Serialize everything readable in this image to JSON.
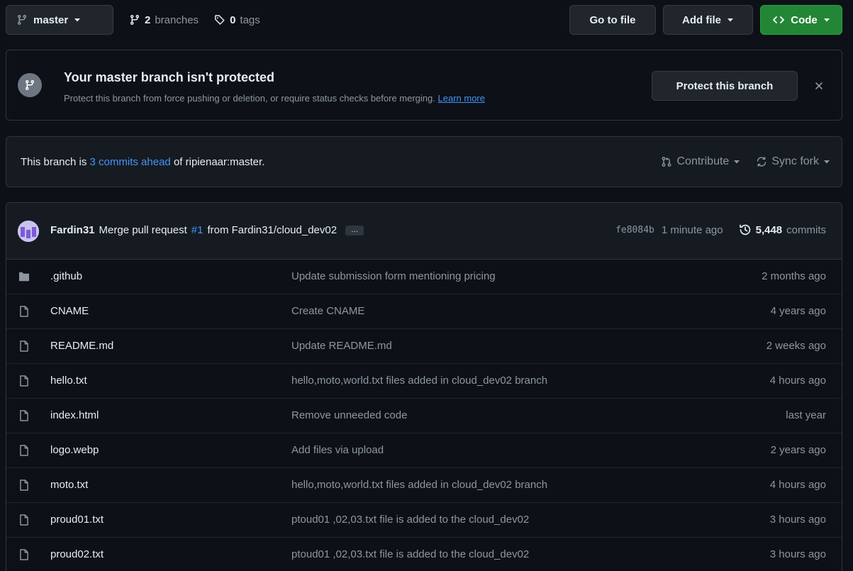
{
  "toolbar": {
    "branch": "master",
    "branches_count": "2",
    "branches_label": "branches",
    "tags_count": "0",
    "tags_label": "tags",
    "goto_label": "Go to file",
    "addfile_label": "Add file",
    "code_label": "Code"
  },
  "banner": {
    "title": "Your master branch isn't protected",
    "description": "Protect this branch from force pushing or deletion, or require status checks before merging.",
    "learn_more": "Learn more",
    "protect_label": "Protect this branch"
  },
  "ahead": {
    "prefix": "This branch is",
    "link": "3 commits ahead",
    "suffix": "of ripienaar:master.",
    "contribute_label": "Contribute",
    "sync_label": "Sync fork"
  },
  "latest_commit": {
    "author": "Fardin31",
    "message_prefix": "Merge pull request",
    "pr_link": "#1",
    "message_suffix": "from Fardin31/cloud_dev02",
    "ellipsis": "…",
    "sha": "fe8084b",
    "time": "1 minute ago",
    "commit_count": "5,448",
    "commit_label": "commits"
  },
  "files": [
    {
      "type": "folder",
      "name": ".github",
      "message": "Update submission form mentioning pricing",
      "time": "2 months ago"
    },
    {
      "type": "file",
      "name": "CNAME",
      "message": "Create CNAME",
      "time": "4 years ago"
    },
    {
      "type": "file",
      "name": "README.md",
      "message": "Update README.md",
      "time": "2 weeks ago"
    },
    {
      "type": "file",
      "name": "hello.txt",
      "message": "hello,moto,world.txt files added in cloud_dev02 branch",
      "time": "4 hours ago"
    },
    {
      "type": "file",
      "name": "index.html",
      "message": "Remove unneeded code",
      "time": "last year"
    },
    {
      "type": "file",
      "name": "logo.webp",
      "message": "Add files via upload",
      "time": "2 years ago"
    },
    {
      "type": "file",
      "name": "moto.txt",
      "message": "hello,moto,world.txt files added in cloud_dev02 branch",
      "time": "4 hours ago"
    },
    {
      "type": "file",
      "name": "proud01.txt",
      "message": "ptoud01 ,02,03.txt file is added to the cloud_dev02",
      "time": "3 hours ago"
    },
    {
      "type": "file",
      "name": "proud02.txt",
      "message": "ptoud01 ,02,03.txt file is added to the cloud_dev02",
      "time": "3 hours ago"
    }
  ],
  "colors": {
    "background": "#0d1117",
    "accent_green": "#238636",
    "link_blue": "#4493f8",
    "muted_text": "#8d96a0"
  }
}
